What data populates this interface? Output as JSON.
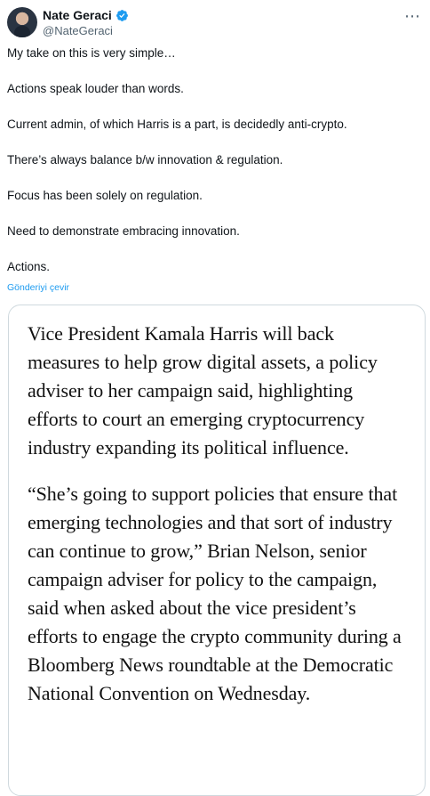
{
  "author": {
    "name": "Nate Geraci",
    "handle": "@NateGeraci",
    "verified_icon": "verified-badge-icon"
  },
  "actions": {
    "more_icon": "more-horizontal-icon"
  },
  "tweet": {
    "lines": [
      "My take on this is very simple…",
      "Actions speak louder than words.",
      "Current admin, of which Harris is a part, is decidedly anti-crypto.",
      "There’s always balance b/w innovation & regulation.",
      "Focus has been solely on regulation.",
      "Need to demonstrate embracing innovation.",
      "Actions."
    ],
    "translate_label": "Gönderiyi çevir"
  },
  "media": {
    "paragraph_1": "Vice President Kamala Harris will back measures to help grow digital assets, a policy adviser to her campaign said, highlighting efforts to court an emerging cryptocurrency industry expanding its political influence.",
    "paragraph_2": "“She’s going to support policies that ensure that emerging technologies and that sort of industry can continue to grow,” Brian Nelson, senior campaign adviser for policy to the campaign, said when asked about the vice president’s efforts to engage the crypto community during a Bloomberg News roundtable at the Democratic National Convention on Wednesday."
  },
  "colors": {
    "accent": "#1d9bf0",
    "secondary_text": "#536471",
    "border": "#cfd9de"
  }
}
